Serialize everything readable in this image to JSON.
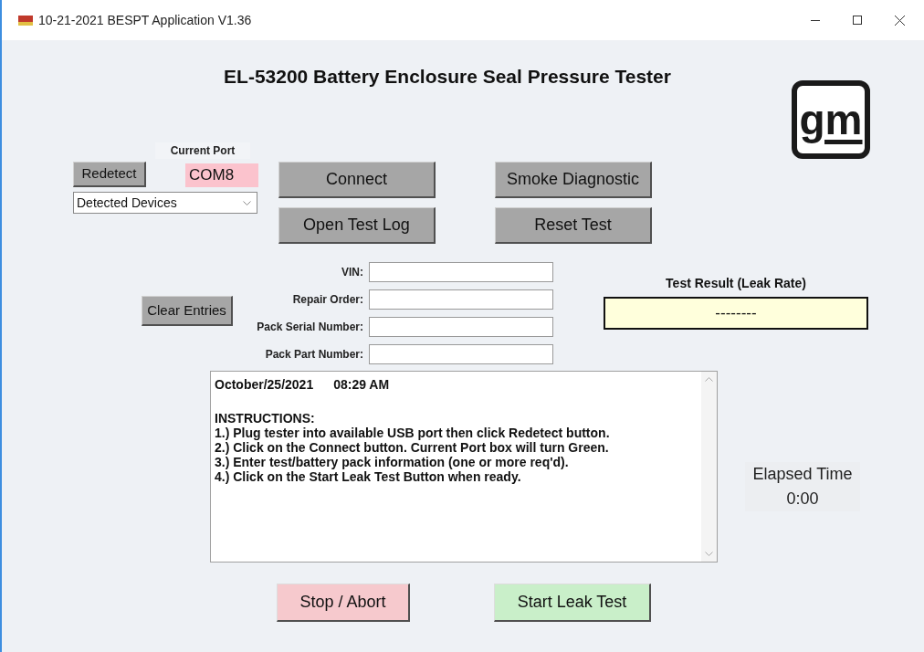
{
  "window": {
    "title": "10-21-2021 BESPT Application V1.36"
  },
  "heading": "EL-53200 Battery Enclosure Seal Pressure Tester",
  "logo": "gm",
  "redetect_button": "Redetect",
  "current_port": {
    "label": "Current Port",
    "value": "COM8",
    "color": "#fbc3cd"
  },
  "devices_dropdown": {
    "value": "Detected Devices"
  },
  "buttons": [
    {
      "label": "Connect"
    },
    {
      "label": "Open Test Log"
    }
  ],
  "buttons_right": [
    {
      "label": "Smoke Diagnostic"
    },
    {
      "label": "Reset Test"
    }
  ],
  "clear_button": "Clear Entries",
  "fields": [
    {
      "label": "VIN:"
    },
    {
      "label": "Repair Order:"
    },
    {
      "label": "Pack Serial Number:"
    },
    {
      "label": "Pack Part Number:"
    }
  ],
  "test_result": {
    "label": "Test Result (Leak Rate)",
    "value": "--------"
  },
  "log": {
    "date": "October/25/2021",
    "time": "08:29 AM",
    "lines": [
      "INSTRUCTIONS:",
      "1.) Plug tester into available USB port then click Redetect button.",
      "2.) Click on the Connect button. Current Port box will turn Green.",
      "3.) Enter test/battery pack information (one or more req'd).",
      "4.) Click on the Start Leak Test Button when ready."
    ]
  },
  "elapsed": {
    "label": "Elapsed Time",
    "value": "0:00"
  },
  "stop_button": "Stop / Abort",
  "start_button": "Start Leak Test"
}
